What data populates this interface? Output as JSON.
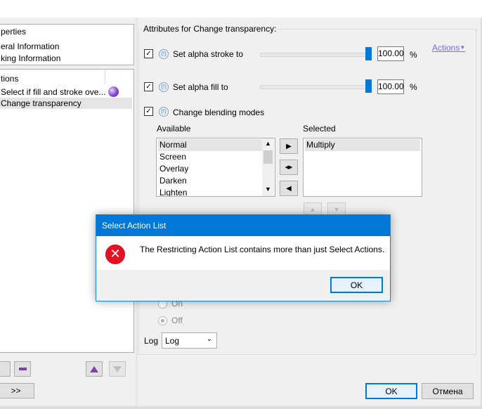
{
  "left_panel": {
    "tree_top_items": [
      "perties",
      "eral Information",
      "king Information"
    ],
    "tree_mid_items": [
      "tions",
      "Select if fill and stroke ove...",
      "Change transparency"
    ],
    "bottom_button": ">>"
  },
  "attributes": {
    "group_title": "Attributes for Change transparency:",
    "actions_link": "Actions",
    "stroke": {
      "label": "Set alpha stroke to",
      "value": "100.00",
      "unit": "%",
      "checked": true,
      "level": 1.0
    },
    "fill": {
      "label": "Set alpha fill to",
      "value": "100.00",
      "unit": "%",
      "checked": true,
      "level": 1.0
    },
    "blending": {
      "label": "Change blending modes",
      "checked": true
    },
    "available_label": "Available",
    "selected_label": "Selected",
    "available_items": [
      "Normal",
      "Screen",
      "Overlay",
      "Darken",
      "Lighten"
    ],
    "selected_items": [
      "Multiply"
    ],
    "radio_on": "On",
    "radio_off": "Off",
    "log_label": "Log",
    "log_value": "Log"
  },
  "footer": {
    "ok_label": "OK",
    "cancel_label": "Отмена"
  },
  "dialog": {
    "title": "Select Action List",
    "message": "The Restricting Action List contains more than just Select Actions.",
    "ok_label": "OK"
  },
  "colors": {
    "accent": "#0078d7",
    "error": "#e81123",
    "link": "#7b68ee",
    "selection_gray": "#e5e5e5"
  }
}
